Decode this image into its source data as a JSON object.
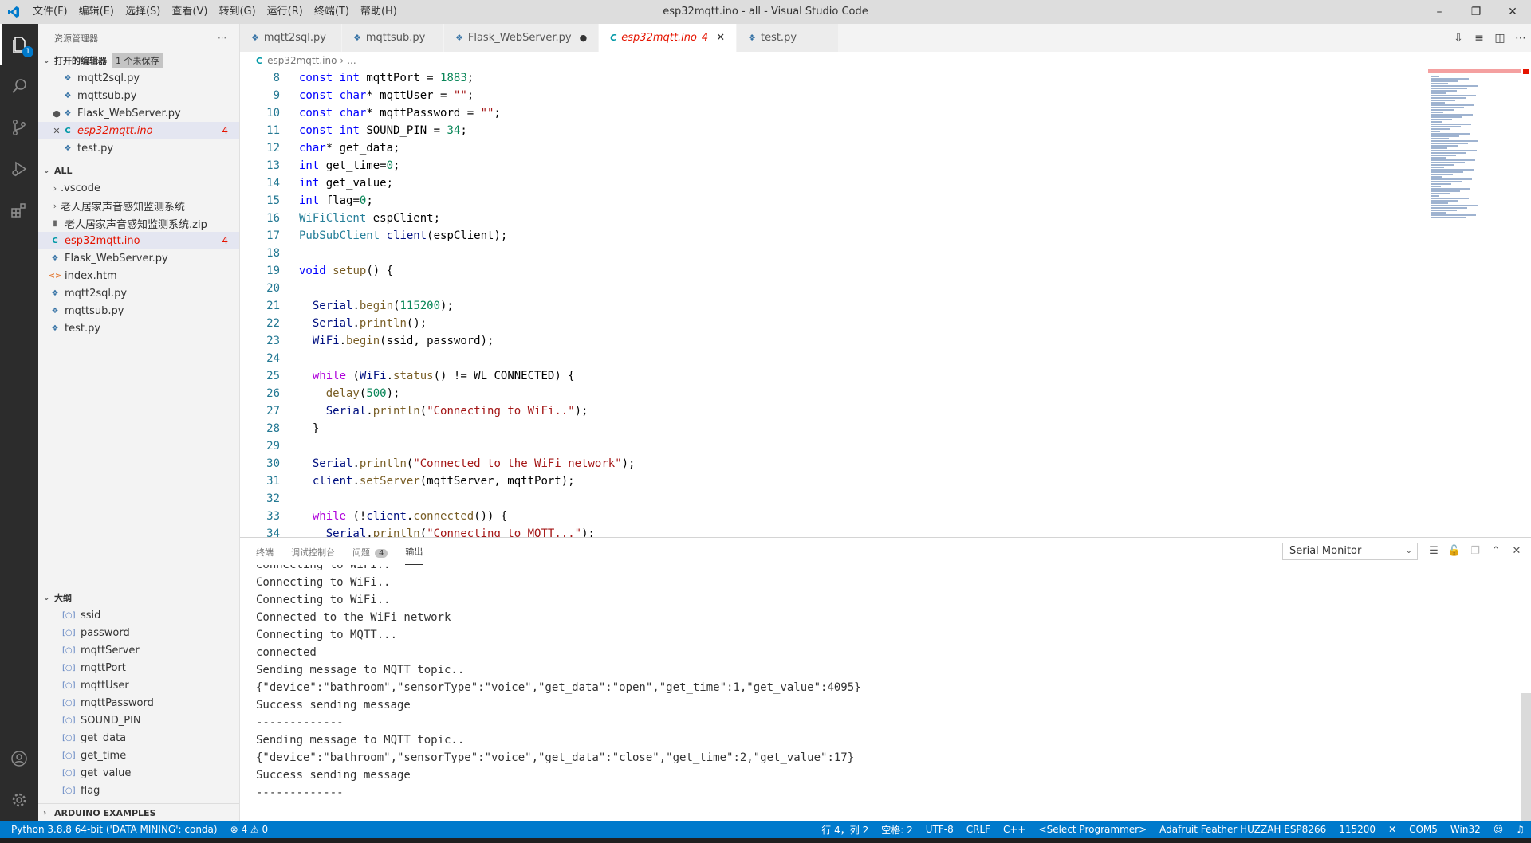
{
  "titlebar": {
    "menu": [
      "文件(F)",
      "编辑(E)",
      "选择(S)",
      "查看(V)",
      "转到(G)",
      "运行(R)",
      "终端(T)",
      "帮助(H)"
    ],
    "title": "esp32mqtt.ino - all - Visual Studio Code"
  },
  "activitybar": {
    "explorer_badge": "1"
  },
  "sidebar": {
    "title": "资源管理器",
    "open_editors": {
      "label": "打开的编辑器",
      "unsaved_tag": "1 个未保存",
      "items": [
        {
          "name": "mqtt2sql.py",
          "icon": "python-file-icon",
          "lead": "",
          "error": ""
        },
        {
          "name": "mqttsub.py",
          "icon": "python-file-icon",
          "lead": "",
          "error": ""
        },
        {
          "name": "Flask_WebServer.py",
          "icon": "python-file-icon",
          "lead": "●",
          "error": ""
        },
        {
          "name": "esp32mqtt.ino",
          "icon": "arduino-file-icon",
          "lead": "✕",
          "error": "4"
        },
        {
          "name": "test.py",
          "icon": "python-file-icon",
          "lead": "",
          "error": ""
        }
      ]
    },
    "workspace": {
      "label": "ALL",
      "items": [
        {
          "name": ".vscode",
          "type": "folder"
        },
        {
          "name": "老人居家声音感知监测系统",
          "type": "folder"
        },
        {
          "name": "老人居家声音感知监测系统.zip",
          "type": "zip"
        },
        {
          "name": "esp32mqtt.ino",
          "type": "ino",
          "error": "4"
        },
        {
          "name": "Flask_WebServer.py",
          "type": "py"
        },
        {
          "name": "index.htm",
          "type": "htm"
        },
        {
          "name": "mqtt2sql.py",
          "type": "py"
        },
        {
          "name": "mqttsub.py",
          "type": "py"
        },
        {
          "name": "test.py",
          "type": "py"
        }
      ]
    },
    "outline": {
      "label": "大纲",
      "items": [
        "ssid",
        "password",
        "mqttServer",
        "mqttPort",
        "mqttUser",
        "mqttPassword",
        "SOUND_PIN",
        "get_data",
        "get_time",
        "get_value",
        "flag"
      ]
    },
    "arduino_examples": "ARDUINO EXAMPLES"
  },
  "tabs": [
    {
      "label": "mqtt2sql.py",
      "suffix": ""
    },
    {
      "label": "mqttsub.py",
      "suffix": ""
    },
    {
      "label": "Flask_WebServer.py",
      "suffix": "●"
    },
    {
      "label": "esp32mqtt.ino",
      "suffix": "4",
      "active": true
    },
    {
      "label": "test.py",
      "suffix": ""
    }
  ],
  "breadcrumb": {
    "file": "esp32mqtt.ino",
    "rest": "..."
  },
  "code_lines": [
    {
      "n": "8",
      "text": "const int mqttPort = 1883;"
    },
    {
      "n": "9",
      "text": "const char* mqttUser = \"\";"
    },
    {
      "n": "10",
      "text": "const char* mqttPassword = \"\";"
    },
    {
      "n": "11",
      "text": "const int SOUND_PIN = 34;"
    },
    {
      "n": "12",
      "text": "char* get_data;"
    },
    {
      "n": "13",
      "text": "int get_time=0;"
    },
    {
      "n": "14",
      "text": "int get_value;"
    },
    {
      "n": "15",
      "text": "int flag=0;"
    },
    {
      "n": "16",
      "text": "WiFiClient espClient;"
    },
    {
      "n": "17",
      "text": "PubSubClient client(espClient);"
    },
    {
      "n": "18",
      "text": ""
    },
    {
      "n": "19",
      "text": "void setup() {"
    },
    {
      "n": "20",
      "text": ""
    },
    {
      "n": "21",
      "text": "  Serial.begin(115200);"
    },
    {
      "n": "22",
      "text": "  Serial.println();"
    },
    {
      "n": "23",
      "text": "  WiFi.begin(ssid, password);"
    },
    {
      "n": "24",
      "text": ""
    },
    {
      "n": "25",
      "text": "  while (WiFi.status() != WL_CONNECTED) {"
    },
    {
      "n": "26",
      "text": "    delay(500);"
    },
    {
      "n": "27",
      "text": "    Serial.println(\"Connecting to WiFi..\");"
    },
    {
      "n": "28",
      "text": "  }"
    },
    {
      "n": "29",
      "text": ""
    },
    {
      "n": "30",
      "text": "  Serial.println(\"Connected to the WiFi network\");"
    },
    {
      "n": "31",
      "text": "  client.setServer(mqttServer, mqttPort);"
    },
    {
      "n": "32",
      "text": ""
    },
    {
      "n": "33",
      "text": "  while (!client.connected()) {"
    },
    {
      "n": "34",
      "text": "    Serial.println(\"Connecting to MQTT...\");"
    }
  ],
  "panel": {
    "tabs": [
      "终端",
      "调试控制台",
      "问题",
      "输出"
    ],
    "problems_count": "4",
    "channel": "Serial Monitor",
    "output_lines": [
      "Connecting to WiFi..",
      "Connecting to WiFi..",
      "Connecting to WiFi..",
      "Connected to the WiFi network",
      "Connecting to MQTT...",
      "connected",
      "Sending message to MQTT topic..",
      "{\"device\":\"bathroom\",\"sensorType\":\"voice\",\"get_data\":\"open\",\"get_time\":1,\"get_value\":4095}",
      "Success sending message",
      "-------------",
      "Sending message to MQTT topic..",
      "{\"device\":\"bathroom\",\"sensorType\":\"voice\",\"get_data\":\"close\",\"get_time\":2,\"get_value\":17}",
      "Success sending message",
      "-------------"
    ]
  },
  "statusbar": {
    "python_env": "Python 3.8.8 64-bit ('DATA MINING': conda)",
    "problems": "⊗ 4 ⚠ 0",
    "position": "行 4，列 2",
    "spaces": "空格: 2",
    "encoding": "UTF-8",
    "eol": "CRLF",
    "language": "C++",
    "programmer": "<Select Programmer>",
    "board": "Adafruit Feather HUZZAH ESP8266",
    "baud": "115200",
    "close_serial": "✕",
    "port": "COM5",
    "platform": "Win32"
  }
}
